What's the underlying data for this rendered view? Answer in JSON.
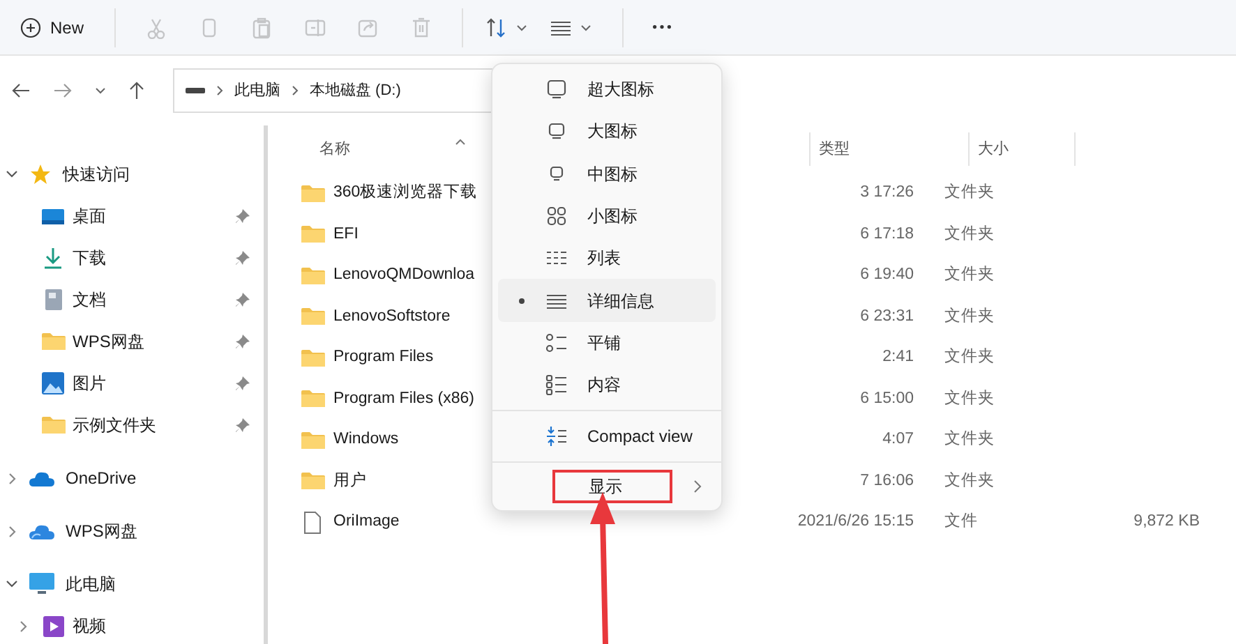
{
  "toolbar": {
    "new_button": {
      "label": "New"
    },
    "actions": [
      {
        "kind": "cut",
        "disabled": true
      },
      {
        "kind": "copy",
        "disabled": true
      },
      {
        "kind": "paste",
        "disabled": true
      },
      {
        "kind": "rename",
        "disabled": true
      },
      {
        "kind": "share",
        "disabled": true
      },
      {
        "kind": "delete",
        "disabled": true
      }
    ],
    "menus": [
      {
        "kind": "sort"
      },
      {
        "kind": "view"
      }
    ]
  },
  "address_bar": {
    "breadcrumbs": [
      "此电脑",
      "本地磁盘 (D:)"
    ]
  },
  "sidebar": {
    "items": [
      {
        "label": "快速访问",
        "kind": "star",
        "expanded": true,
        "children": [
          {
            "label": "桌面",
            "kind": "desktop",
            "pinned": true
          },
          {
            "label": "下载",
            "kind": "download",
            "pinned": true
          },
          {
            "label": "文档",
            "kind": "document",
            "pinned": true
          },
          {
            "label": "WPS网盘",
            "kind": "folder",
            "pinned": true
          },
          {
            "label": "图片",
            "kind": "pictures",
            "pinned": true
          },
          {
            "label": "示例文件夹",
            "kind": "folder",
            "pinned": true
          }
        ]
      },
      {
        "label": "OneDrive",
        "kind": "cloud",
        "expanded": false
      },
      {
        "label": "WPS网盘",
        "kind": "cloud2",
        "expanded": false
      },
      {
        "label": "此电脑",
        "kind": "pc",
        "expanded": true,
        "children": [
          {
            "label": "视频",
            "kind": "video",
            "expanded": false
          }
        ]
      }
    ]
  },
  "file_list": {
    "columns": [
      "名称",
      "类型",
      "大小"
    ],
    "rows": [
      {
        "name": "360极速浏览器下载",
        "kind": "folder",
        "date": "3 17:26",
        "type": "文件夹"
      },
      {
        "name": "EFI",
        "kind": "folder",
        "date": "6 17:18",
        "type": "文件夹"
      },
      {
        "name": "LenovoQMDownloa",
        "kind": "folder",
        "date": "6 19:40",
        "type": "文件夹"
      },
      {
        "name": "LenovoSoftstore",
        "kind": "folder",
        "date": "6 23:31",
        "type": "文件夹"
      },
      {
        "name": "Program Files",
        "kind": "folder",
        "date": "2:41",
        "type": "文件夹"
      },
      {
        "name": "Program Files (x86)",
        "kind": "folder",
        "date": "6 15:00",
        "type": "文件夹"
      },
      {
        "name": "Windows",
        "kind": "folder",
        "date": "4:07",
        "type": "文件夹"
      },
      {
        "name": "用户",
        "kind": "folder",
        "date": "7 16:06",
        "type": "文件夹"
      },
      {
        "name": "OriImage",
        "kind": "file",
        "date": "2021/6/26 15:15",
        "type": "文件",
        "size": "9,872 KB"
      }
    ]
  },
  "view_menu": {
    "items": [
      {
        "label": "超大图标",
        "kind": "xl",
        "selected": false
      },
      {
        "label": "大图标",
        "kind": "large",
        "selected": false
      },
      {
        "label": "中图标",
        "kind": "medium",
        "selected": false
      },
      {
        "label": "小图标",
        "kind": "small",
        "selected": false
      },
      {
        "label": "列表",
        "kind": "list",
        "selected": false
      },
      {
        "label": "详细信息",
        "kind": "details",
        "selected": true
      },
      {
        "label": "平铺",
        "kind": "tiles",
        "selected": false
      },
      {
        "label": "内容",
        "kind": "content",
        "selected": false
      }
    ],
    "compact": {
      "label": "Compact view",
      "checked": false
    },
    "show": {
      "label": "显示",
      "outlined": true,
      "callout_arrow": true
    }
  }
}
